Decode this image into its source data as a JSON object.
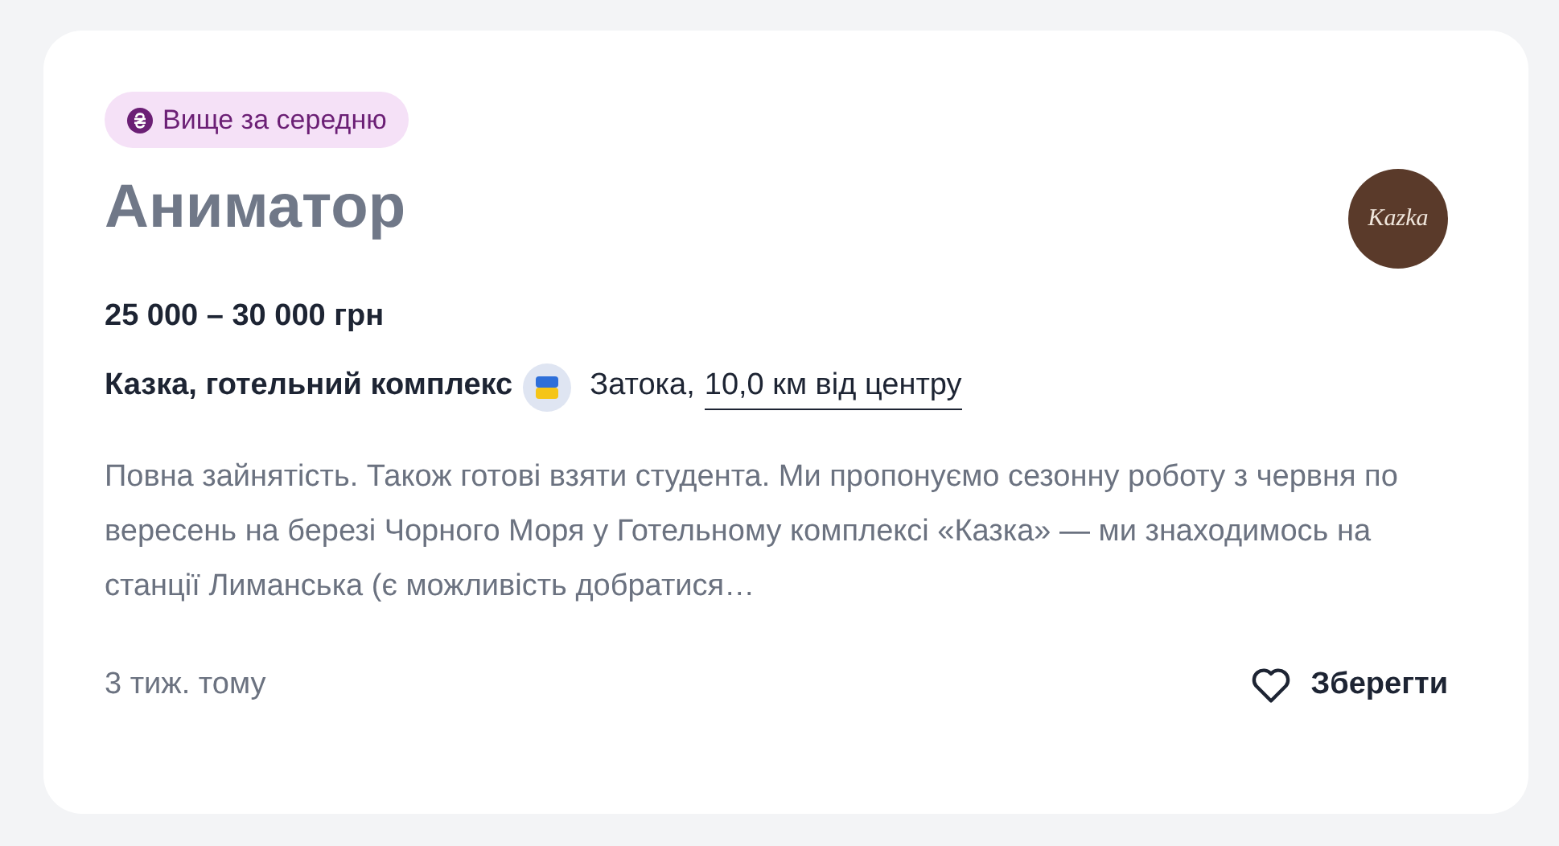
{
  "badge": {
    "label": "Вище за середню"
  },
  "title": "Аниматор",
  "logo": {
    "text": "Kazka"
  },
  "salary": "25 000 – 30 000 грн",
  "company": "Казка, готельний комплекс",
  "location": {
    "city": "Затока,",
    "distance": "10,0 км від центру"
  },
  "description": "Повна зайнятість. Також готові взяти студента. Ми пропонуємо сезонну роботу з червня по вересень на березі Чорного Моря у Готельному комплексі «Казка» — ми знаходимось на станції Лиманська (є можливість добратися…",
  "posted": "3 тиж. тому",
  "save": {
    "label": "Зберегти",
    "saved": false
  }
}
